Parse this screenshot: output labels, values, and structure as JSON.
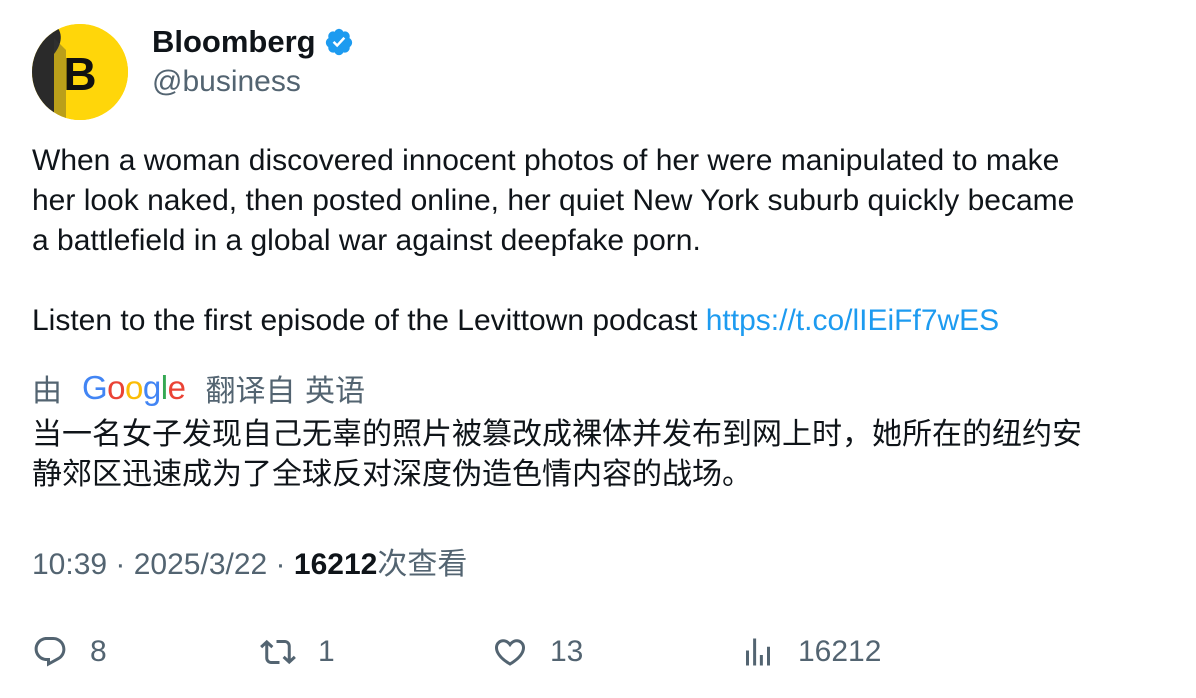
{
  "author": {
    "name": "Bloomberg",
    "handle": "@business",
    "avatar_letter": "B",
    "verified": true
  },
  "tweet": {
    "lines": [
      "When a woman discovered innocent photos of her were manipulated to make",
      "her look naked, then posted online, her quiet New York suburb quickly became",
      "a battlefield in a global war against deepfake porn."
    ],
    "listen_text": "Listen to the first episode of the Levittown podcast ",
    "link_text": "https://t.co/lIEiFf7wES"
  },
  "translation": {
    "prefix": "由",
    "provider": "Google",
    "suffix": "翻译自 英语",
    "lines": [
      "当一名女子发现自己无辜的照片被篡改成裸体并发布到网上时，她所在的纽约安",
      "静郊区迅速成为了全球反对深度伪造色情内容的战场。"
    ]
  },
  "meta": {
    "time": "10:39",
    "separator": " · ",
    "date": "2025/3/22",
    "views": "16212",
    "views_label": "次查看"
  },
  "actions": {
    "replies": "8",
    "retweets": "1",
    "likes": "13",
    "views": "16212"
  },
  "colors": {
    "accent_link": "#1d9bf0",
    "secondary_text": "#536471",
    "avatar_bg": "#ffd60a"
  },
  "icons": [
    "verified-badge-icon",
    "reply-icon",
    "retweet-icon",
    "like-icon",
    "views-chart-icon"
  ]
}
